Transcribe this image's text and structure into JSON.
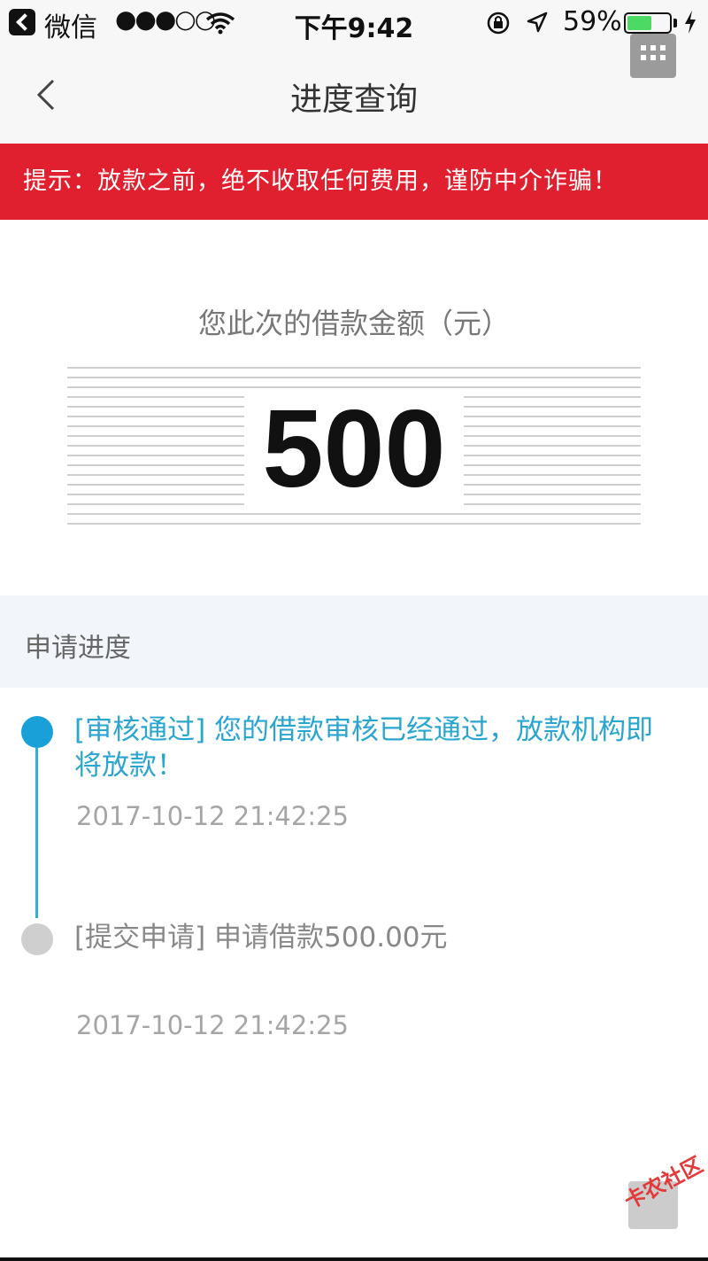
{
  "status_bar": {
    "app_name": "微信",
    "signal": "●●●○○",
    "time": "下午9:42",
    "battery_percent": "59%",
    "battery_level": 0.59,
    "icons": [
      "back-to-app-icon",
      "wifi-icon",
      "rotation-lock-icon",
      "location-arrow-icon",
      "battery-icon",
      "charging-bolt-icon"
    ]
  },
  "nav": {
    "title": "进度查询",
    "icons": [
      "back-chevron-icon",
      "grid-menu-icon"
    ]
  },
  "notice": {
    "text": "提示：放款之前，绝不收取任何费用，谨防中介诈骗！",
    "background": "#e0202e"
  },
  "amount": {
    "label": "您此次的借款金额（元）",
    "value": "500"
  },
  "progress": {
    "title": "申请进度",
    "accent": "#1aa0d8",
    "steps": [
      {
        "text": "[审核通过] 您的借款审核已经通过，放款机构即将放款！",
        "time": "2017-10-12 21:42:25",
        "active": true
      },
      {
        "text": "[提交申请] 申请借款500.00元",
        "time": "2017-10-12 21:42:25",
        "active": false
      }
    ]
  },
  "watermark": "卡农社区"
}
